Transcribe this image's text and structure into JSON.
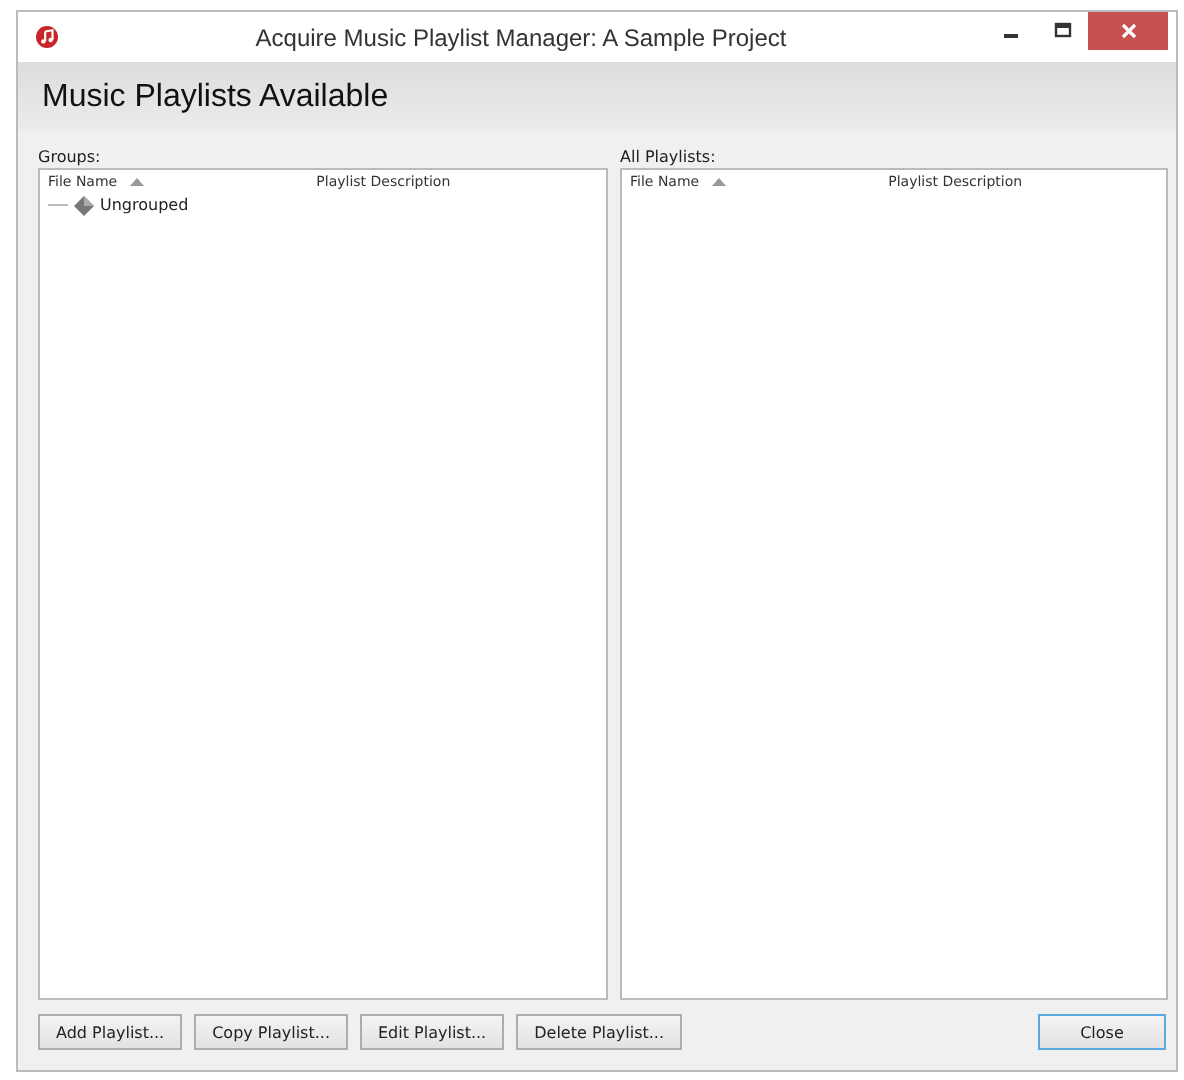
{
  "window": {
    "title": "Acquire Music Playlist Manager: A Sample Project"
  },
  "header": "Music Playlists Available",
  "panels": [
    {
      "label": "Groups:",
      "columns": [
        {
          "label": "File Name",
          "sorted": true
        },
        {
          "label": "Playlist Description",
          "sorted": false
        }
      ],
      "items": [
        {
          "label": "Ungrouped"
        }
      ]
    },
    {
      "label": "All Playlists:",
      "columns": [
        {
          "label": "File Name",
          "sorted": true
        },
        {
          "label": "Playlist Description",
          "sorted": false
        }
      ]
    }
  ],
  "buttons": [
    {
      "label": "Add Playlist...",
      "default": false
    },
    {
      "label": "Copy Playlist...",
      "default": false
    },
    {
      "label": "Edit Playlist...",
      "default": false
    },
    {
      "label": "Delete Playlist...",
      "default": false
    }
  ],
  "close_button": {
    "label": "Close",
    "default": true
  }
}
